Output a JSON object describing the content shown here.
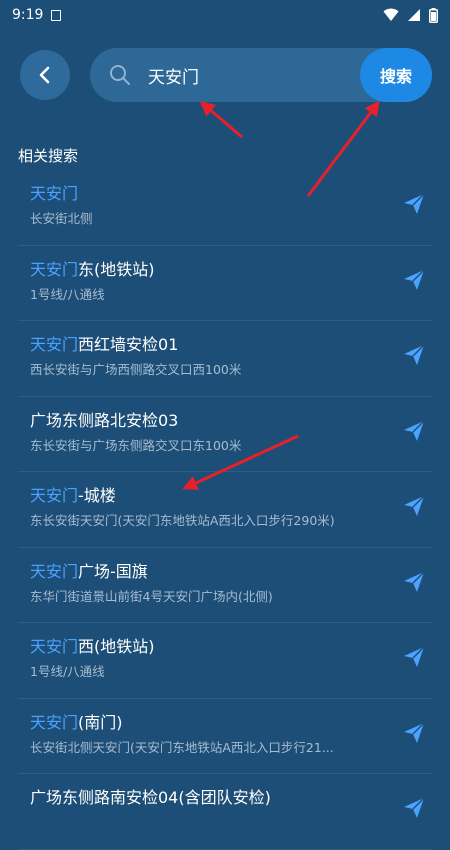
{
  "status_bar": {
    "time": "9:19"
  },
  "search": {
    "query": "天安门",
    "button_label": "搜索"
  },
  "section_title": "相关搜索",
  "results": [
    {
      "highlight": "天安门",
      "rest": "",
      "subtitle": "长安街北侧"
    },
    {
      "highlight": "天安门",
      "rest": "东(地铁站)",
      "subtitle": "1号线/八通线"
    },
    {
      "highlight": "天安门",
      "rest": "西红墙安检01",
      "subtitle": "西长安街与广场西侧路交叉口西100米"
    },
    {
      "highlight": "",
      "rest": "广场东侧路北安检03",
      "subtitle": "东长安街与广场东侧路交叉口东100米"
    },
    {
      "highlight": "天安门",
      "rest": "-城楼",
      "subtitle": "东长安街天安门(天安门东地铁站A西北入口步行290米)"
    },
    {
      "highlight": "天安门",
      "rest": "广场-国旗",
      "subtitle": "东华门街道景山前街4号天安门广场内(北侧)"
    },
    {
      "highlight": "天安门",
      "rest": "西(地铁站)",
      "subtitle": "1号线/八通线"
    },
    {
      "highlight": "天安门",
      "rest": "(南门)",
      "subtitle": "长安街北侧天安门(天安门东地铁站A西北入口步行21..."
    },
    {
      "highlight": "",
      "rest": "广场东侧路南安检04(含团队安检)",
      "subtitle": ""
    }
  ],
  "icons": {
    "back": "chevron-left-icon",
    "search": "search-icon",
    "navigate": "paper-plane-icon"
  },
  "colors": {
    "background": "#1d4e77",
    "search_box": "#2d6896",
    "search_button": "#1e88e5",
    "highlight": "#4aa3ff",
    "annotation_arrow": "#e8202a"
  }
}
